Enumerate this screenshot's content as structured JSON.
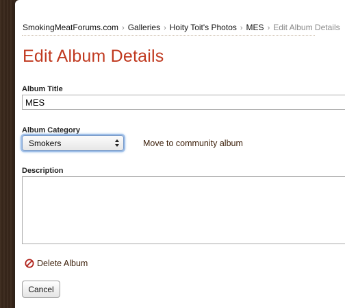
{
  "breadcrumb": {
    "items": [
      "SmokingMeatForums.com",
      "Galleries",
      "Hoity Toit's Photos",
      "MES"
    ],
    "current": "Edit Album Details",
    "separator": "›"
  },
  "page": {
    "title": "Edit Album Details"
  },
  "form": {
    "album_title_label": "Album Title",
    "album_title_value": "MES",
    "album_category_label": "Album Category",
    "album_category_value": "Smokers",
    "move_link": "Move to community album",
    "description_label": "Description",
    "description_value": "",
    "delete_label": "Delete Album",
    "cancel_label": "Cancel"
  },
  "icons": {
    "delete": "no-entry-icon",
    "select_arrows": "updown-arrows-icon"
  },
  "colors": {
    "title": "#c0391f",
    "link": "#3b1e08",
    "delete_icon": "#b0221a",
    "focus_ring": "#9fbfe8",
    "wood": "#2a1c12"
  }
}
